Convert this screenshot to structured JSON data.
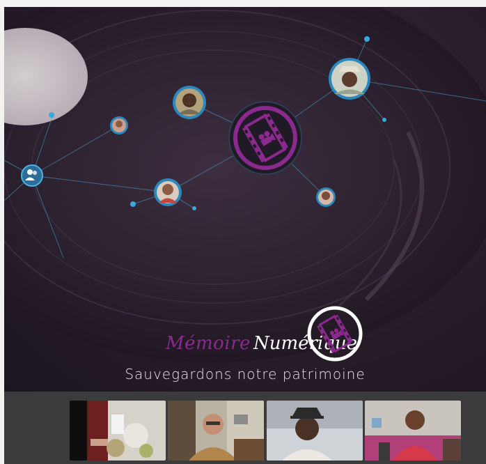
{
  "brand": {
    "word1": "Mémoire",
    "word2": "Numérique",
    "tagline": "Sauvegardons notre patrimoine",
    "accent_color": "#8a2a8e",
    "logo_icon": "film-camera-icon"
  },
  "network": {
    "hub_icon": "film-camera-icon",
    "group_icon": "users-icon",
    "node_color": "#3aa7dc"
  },
  "videos": [
    {
      "id": "cooking",
      "icon": "video-thumbnail"
    },
    {
      "id": "elder-glasses",
      "icon": "video-thumbnail"
    },
    {
      "id": "man-hat",
      "icon": "video-thumbnail"
    },
    {
      "id": "man-red-shirt",
      "icon": "video-thumbnail"
    }
  ]
}
